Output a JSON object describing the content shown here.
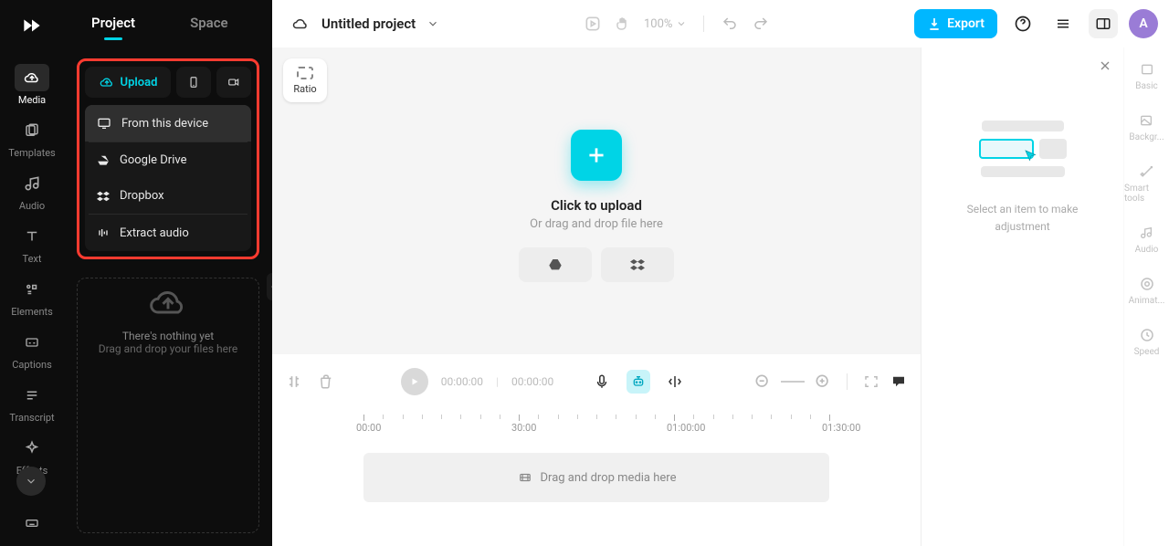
{
  "rail": {
    "items": [
      "Media",
      "Templates",
      "Audio",
      "Text",
      "Elements",
      "Captions",
      "Transcript",
      "Effects"
    ]
  },
  "panel2": {
    "tabs": [
      "Project",
      "Space"
    ],
    "upload_label": "Upload",
    "menu": {
      "from_device": "From this device",
      "gdrive": "Google Drive",
      "dropbox": "Dropbox",
      "extract": "Extract audio"
    },
    "empty_line1": "There's nothing yet",
    "empty_line2": "Drag and drop your files here"
  },
  "topbar": {
    "project_name": "Untitled project",
    "zoom": "100%",
    "export_label": "Export",
    "avatar_letter": "A"
  },
  "stage": {
    "ratio_label": "Ratio",
    "upload_title": "Click to upload",
    "upload_sub": "Or drag and drop file here"
  },
  "timeline": {
    "time_current": "00:00:00",
    "time_total": "00:00:00",
    "ticks": [
      "00:00",
      "30:00",
      "01:00:00",
      "01:30:00"
    ],
    "dropzone": "Drag and drop media here"
  },
  "inspector": {
    "message_l1": "Select an item to make",
    "message_l2": "adjustment"
  },
  "right_rail": {
    "items": [
      "Basic",
      "Backgr...",
      "Smart tools",
      "Audio",
      "Animat...",
      "Speed"
    ]
  }
}
